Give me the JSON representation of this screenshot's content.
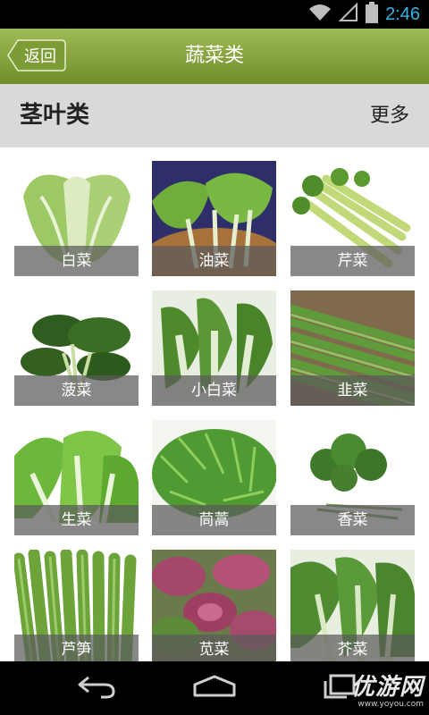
{
  "status_bar": {
    "time": "2:46",
    "icons": [
      "wifi-icon",
      "signal-icon",
      "battery-icon"
    ]
  },
  "header": {
    "back_label": "返回",
    "title": "蔬菜类"
  },
  "section": {
    "title": "茎叶类",
    "more_label": "更多"
  },
  "items": [
    {
      "label": "白菜"
    },
    {
      "label": "油菜"
    },
    {
      "label": "芹菜"
    },
    {
      "label": "菠菜"
    },
    {
      "label": "小白菜"
    },
    {
      "label": "韭菜"
    },
    {
      "label": "生菜"
    },
    {
      "label": "茼蒿"
    },
    {
      "label": "香菜"
    },
    {
      "label": "芦笋"
    },
    {
      "label": "苋菜"
    },
    {
      "label": "芥菜"
    }
  ],
  "nav_bar": {
    "icons": [
      "back-icon",
      "home-icon",
      "recents-icon"
    ]
  },
  "watermark": {
    "text": "优游网",
    "sub": "www.yoyou.com"
  },
  "colors": {
    "header_green": "#8aa83f",
    "section_gray": "#d9d9d9",
    "clock_blue": "#33b5e5"
  }
}
